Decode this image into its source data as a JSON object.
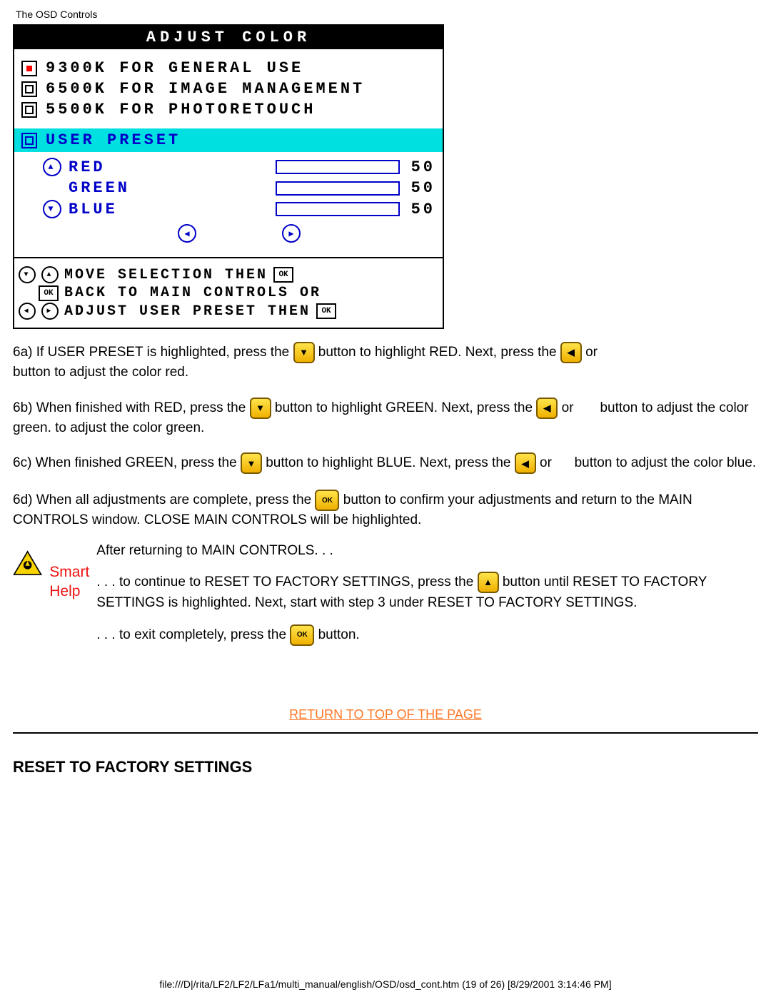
{
  "meta": {
    "page_title": "The OSD Controls",
    "footer_path": "file:///D|/rita/LF2/LF2/LFa1/multi_manual/english/OSD/osd_cont.htm (19 of 26) [8/29/2001 3:14:46 PM]"
  },
  "osd": {
    "title": "ADJUST COLOR",
    "options": [
      {
        "key": "9300",
        "label": "9300K FOR GENERAL USE",
        "selected": true
      },
      {
        "key": "6500",
        "label": "6500K FOR IMAGE MANAGEMENT",
        "selected": false
      },
      {
        "key": "5500",
        "label": "5500K FOR PHOTORETOUCH",
        "selected": false
      }
    ],
    "user_preset_label": "USER PRESET",
    "colors": [
      {
        "name": "RED",
        "value": 50
      },
      {
        "name": "GREEN",
        "value": 50
      },
      {
        "name": "BLUE",
        "value": 50
      }
    ],
    "footer_lines": {
      "l1": "MOVE SELECTION THEN",
      "l2": "BACK TO MAIN CONTROLS OR",
      "l3": "ADJUST USER PRESET THEN"
    }
  },
  "instructions": {
    "p6a_a": "6a) If USER PRESET is highlighted, press the ",
    "p6a_b": " button to highlight RED. Next, press the ",
    "p6a_c": " or",
    "p6a_d": "button to adjust the color red.",
    "p6b_a": "6b) When finished with RED, press the ",
    "p6b_b": " button to highlight GREEN. Next, press the ",
    "p6b_c": " or",
    "p6b_d": "button to adjust the color green.",
    "p6c_a": "6c) When finished GREEN, press the ",
    "p6c_b": " button to highlight BLUE. Next, press the ",
    "p6c_c": " or",
    "p6c_d": "button to adjust the color blue.",
    "p6d_a": "6d) When all adjustments are complete, press the ",
    "p6d_b": " button to confirm your adjustments and return to the MAIN CONTROLS window. CLOSE MAIN CONTROLS will be highlighted."
  },
  "smart_help": {
    "label_smart": "Smart",
    "label_help": "Help",
    "p1": "After returning to MAIN CONTROLS. . .",
    "p2a": ". . . to continue to RESET TO FACTORY SETTINGS, press the ",
    "p2b": " button until RESET TO FACTORY SETTINGS is highlighted. Next, start with step 3 under RESET TO FACTORY SETTINGS.",
    "p3a": ". . . to exit completely, press the ",
    "p3b": " button."
  },
  "top_link": "RETURN TO TOP OF THE PAGE",
  "section_heading": "RESET TO FACTORY SETTINGS"
}
